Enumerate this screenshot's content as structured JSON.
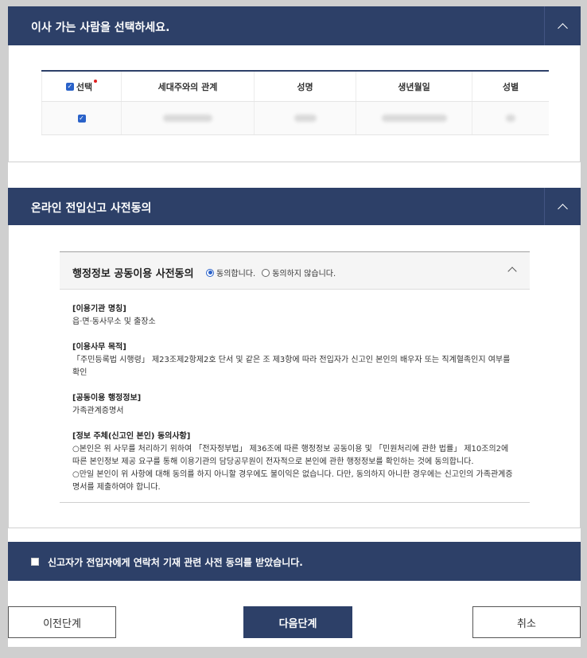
{
  "mover_section": {
    "title": "이사 가는 사람을 선택하세요.",
    "table": {
      "headers": [
        "선택",
        "세대주와의 관계",
        "성명",
        "생년월일",
        "성별"
      ],
      "rows": [
        {
          "selected": true,
          "relation": "",
          "name": "",
          "birth": "",
          "gender": ""
        }
      ]
    }
  },
  "consent_section": {
    "title": "온라인 전입신고 사전동의",
    "agreement": {
      "title": "행정정보 공동이용 사전동의",
      "options": [
        "동의합니다.",
        "동의하지 않습니다."
      ],
      "selected": 0,
      "blocks": [
        {
          "label": "[이용기관 명칭]",
          "text": "읍·면·동사무소 및 출장소"
        },
        {
          "label": "[이용사무 목적]",
          "text": "「주민등록법 시행령」 제23조제2항제2호 단서 및 같은 조 제3항에 따라 전입자가 신고인 본인의 배우자 또는 직계혈족인지 여부를 확인"
        },
        {
          "label": "[공동이용 행정정보]",
          "text": "가족관계증명서"
        },
        {
          "label": "[정보 주체(신고인 본인) 동의사항]",
          "text1": "○본인은 위 사무를 처리하기 위하여 「전자정부법」 제36조에 따른 행정정보 공동이용 및 「민원처리에 관한 법률」 제10조의2에 따른 본인정보 제공 요구를 통해 이용기관의 담당공무원이 전자적으로 본인에 관한 행정정보를 확인하는 것에 동의합니다.",
          "text2": "○만일 본인이 위 사항에 대해 동의를 하지 아니할 경우에도 불이익은 없습니다. 다만, 동의하지 아니한 경우에는 신고인의 가족관계증명서를 제출하여야 합니다."
        }
      ]
    }
  },
  "notice": {
    "checked": false,
    "text": "신고자가 전입자에게 연락처 기재 관련 사전 동의를 받았습니다."
  },
  "buttons": {
    "prev": "이전단계",
    "next": "다음단계",
    "cancel": "취소"
  },
  "colors": {
    "primary": "#2d4068",
    "checkbox": "#2a62c9",
    "required": "#e02020"
  }
}
